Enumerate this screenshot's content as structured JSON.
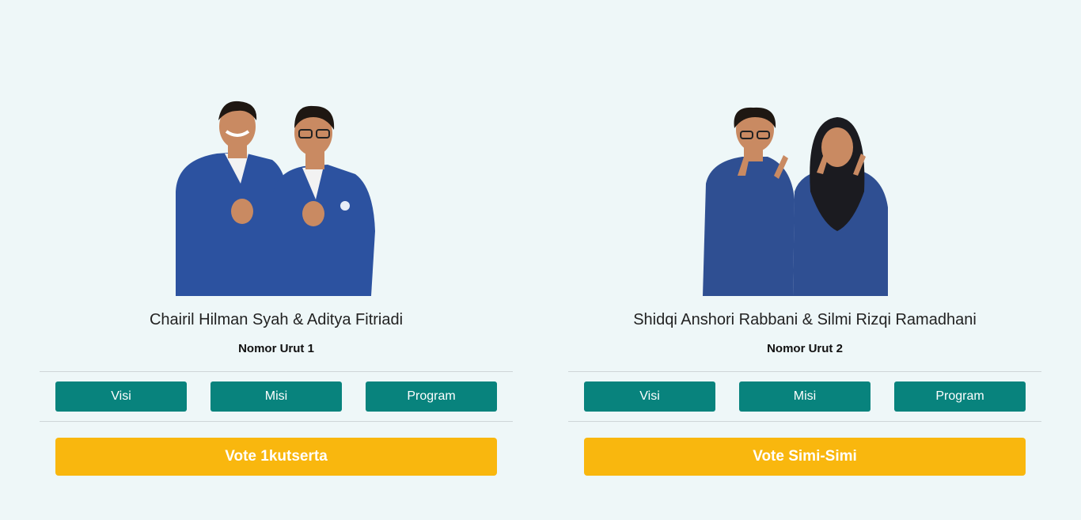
{
  "candidates": [
    {
      "names": "Chairil Hilman Syah & Aditya Fitriadi",
      "number_label": "Nomor Urut 1",
      "buttons": {
        "visi": "Visi",
        "misi": "Misi",
        "program": "Program"
      },
      "vote_label": "Vote 1kutserta"
    },
    {
      "names": "Shidqi Anshori Rabbani & Silmi Rizqi Ramadhani",
      "number_label": "Nomor Urut 2",
      "buttons": {
        "visi": "Visi",
        "misi": "Misi",
        "program": "Program"
      },
      "vote_label": "Vote Simi-Simi"
    }
  ],
  "colors": {
    "background": "#eef7f8",
    "info_button": "#08837d",
    "vote_button": "#f9b70e",
    "jacket": "#2c52a0"
  }
}
